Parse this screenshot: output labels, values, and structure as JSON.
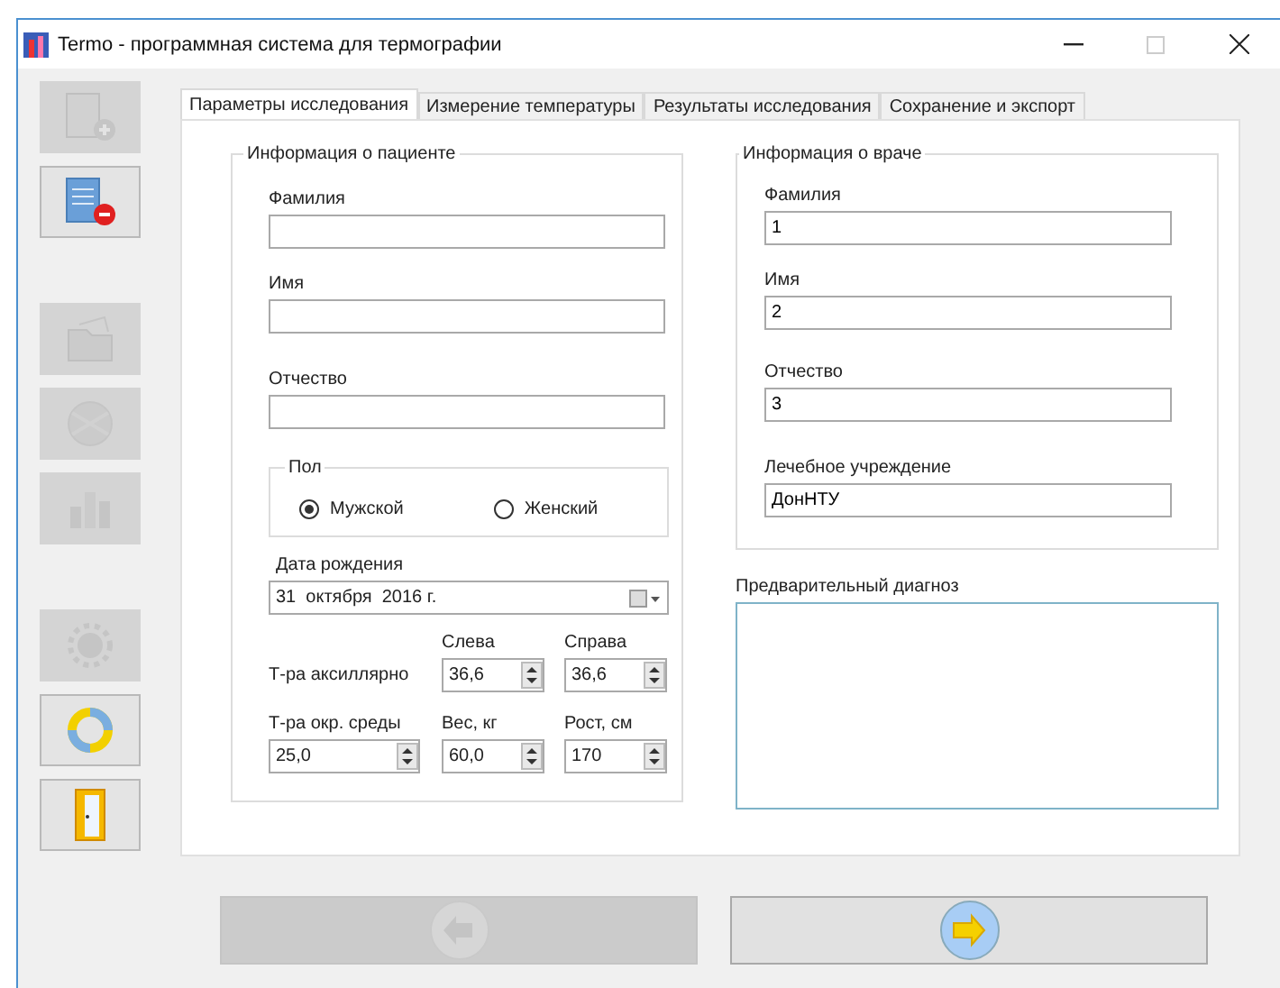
{
  "window": {
    "title": "Termo - программная система для термографии",
    "maximize_disabled": true
  },
  "toolbar_groups": [
    [
      {
        "kind": "new",
        "disabled": true
      },
      {
        "kind": "delete",
        "disabled": false
      }
    ],
    [
      {
        "kind": "open",
        "disabled": true
      },
      {
        "kind": "globe",
        "disabled": true
      },
      {
        "kind": "chart",
        "disabled": true
      }
    ],
    [
      {
        "kind": "gear",
        "disabled": true
      },
      {
        "kind": "lifebuoy",
        "disabled": false
      },
      {
        "kind": "exit",
        "disabled": false
      }
    ]
  ],
  "tabs": [
    {
      "label": "Параметры исследования",
      "selected": true
    },
    {
      "label": "Измерение температуры",
      "selected": false
    },
    {
      "label": "Результаты исследования",
      "selected": false
    },
    {
      "label": "Сохранение и экспорт",
      "selected": false
    }
  ],
  "patient": {
    "legend": "Информация о пациенте",
    "fields": [
      {
        "label": "Фамилия"
      },
      {
        "label": "Имя"
      },
      {
        "label": "Отчество"
      }
    ],
    "gender": {
      "legend": "Пол",
      "options": [
        {
          "label": "Мужской",
          "selected": true
        },
        {
          "label": "Женский",
          "selected": false
        }
      ]
    },
    "birth_date": {
      "label": "Дата рождения",
      "value": "31  октября  2016 г."
    },
    "measure_rows": [
      {
        "label": "Т-ра аксиллярно",
        "spins": [
          {
            "label": "Слева",
            "value": "36,6"
          },
          {
            "label": "Справа",
            "value": "36,6"
          }
        ]
      },
      {
        "spins": [
          {
            "label": "Т-ра окр. среды",
            "value": "25,0"
          },
          {
            "label": "Вес, кг",
            "value": "60,0"
          },
          {
            "label": "Рост, см",
            "value": "170"
          }
        ]
      }
    ]
  },
  "doctor": {
    "legend": "Информация о враче",
    "fields": [
      {
        "label": "Фамилия",
        "value": "1"
      },
      {
        "label": "Имя",
        "value": "2"
      },
      {
        "label": "Отчество",
        "value": "3"
      },
      {
        "label": "Лечебное учреждение",
        "value": "ДонНТУ"
      }
    ]
  },
  "diagnosis": {
    "label": "Предварительный диагноз"
  },
  "nav_buttons": [
    {
      "kind": "back",
      "disabled": true
    },
    {
      "kind": "forward",
      "disabled": false
    }
  ]
}
